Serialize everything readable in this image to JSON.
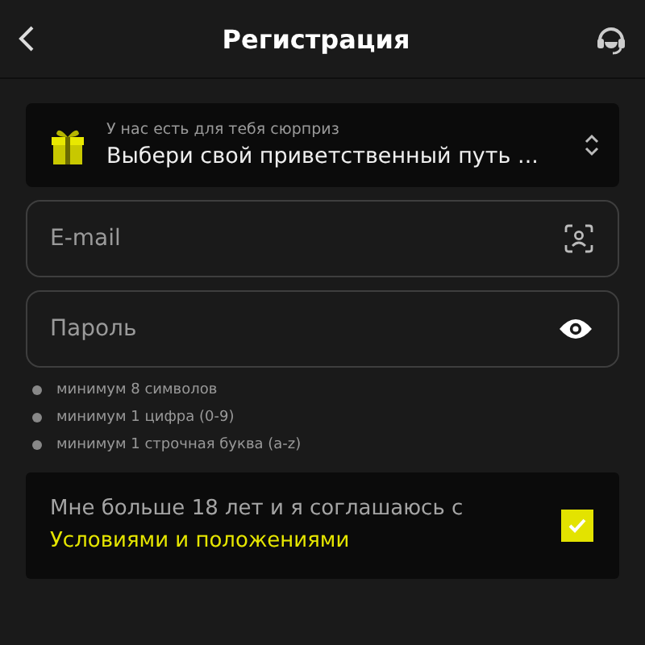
{
  "header": {
    "title": "Регистрация"
  },
  "promo": {
    "caption": "У нас есть для тебя сюрприз",
    "value": "Выбери свой приветственный путь ..."
  },
  "fields": [
    {
      "kind": "email",
      "placeholder": "E-mail"
    },
    {
      "kind": "password",
      "placeholder": "Пароль"
    }
  ],
  "rules": [
    "минимум 8 символов",
    "минимум 1 цифра (0-9)",
    "минимум 1 строчная буква (a-z)"
  ],
  "consent": {
    "text": "Мне больше 18 лет и я соглашаюсь с",
    "link": "Условиями и положениями",
    "checked": true
  }
}
